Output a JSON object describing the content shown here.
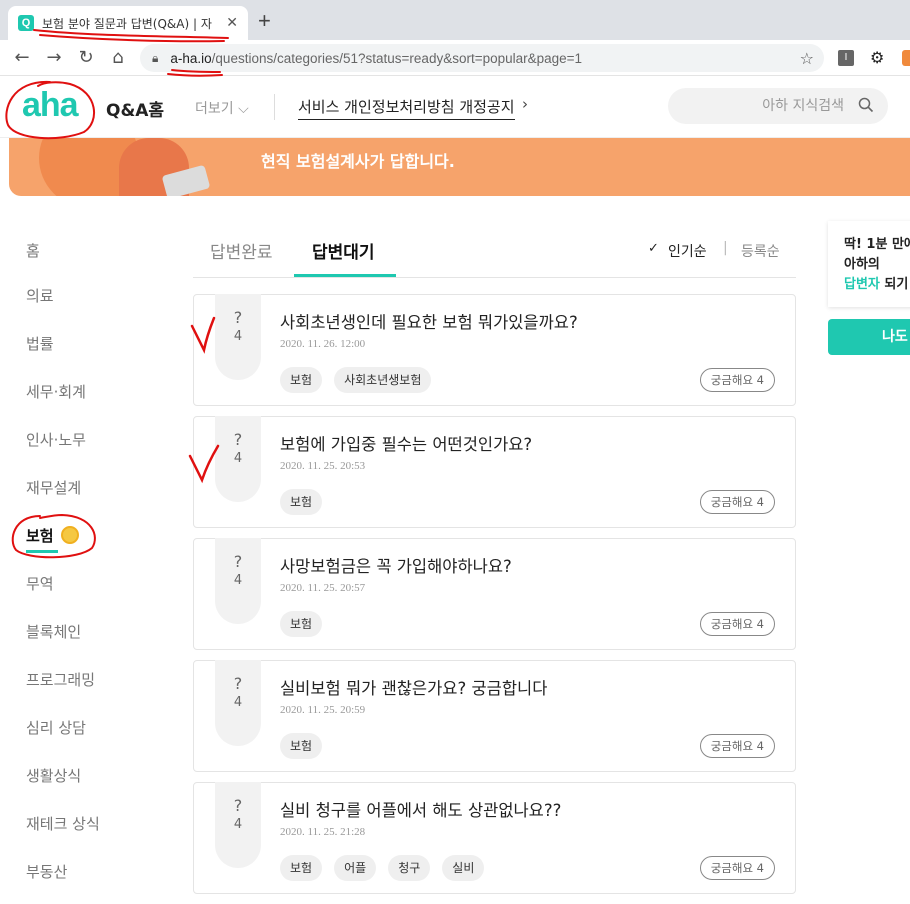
{
  "browser": {
    "tab_title": "보험 분야 질문과 답변(Q&A) | 자",
    "tab_favicon": "Q",
    "url_host": "a-ha.io",
    "url_path": "/questions/categories/51?status=ready&sort=popular&page=1"
  },
  "header": {
    "logo": "aha",
    "home_label": "Q&A홈",
    "more_label": "더보기",
    "notice_label": "서비스 개인정보처리방침 개정공지",
    "search_placeholder": "아하 지식검색"
  },
  "banner": {
    "text": "현직 보험설계사가 답합니다."
  },
  "sidebar": {
    "items": [
      {
        "label": "홈"
      },
      {
        "label": "의료"
      },
      {
        "label": "법률"
      },
      {
        "label": "세무·회계"
      },
      {
        "label": "인사·노무"
      },
      {
        "label": "재무설계"
      },
      {
        "label": "보험",
        "active": true
      },
      {
        "label": "무역"
      },
      {
        "label": "블록체인"
      },
      {
        "label": "프로그래밍"
      },
      {
        "label": "심리 상담"
      },
      {
        "label": "생활상식"
      },
      {
        "label": "재테크 상식"
      },
      {
        "label": "부동산"
      }
    ]
  },
  "tabs": {
    "answered": "답변완료",
    "waiting": "답변대기",
    "active": "waiting",
    "sort_popular": "인기순",
    "sort_recent": "등록순",
    "sort_active": "popular"
  },
  "questions": [
    {
      "title": "사회초년생인데 필요한 보험 뭐가있을까요?",
      "date": "2020. 11. 26. 12:00",
      "count": "4",
      "tags": [
        "보험",
        "사회초년생보험"
      ],
      "curious": "궁금해요 4"
    },
    {
      "title": "보험에 가입중 필수는 어떤것인가요?",
      "date": "2020. 11. 25. 20:53",
      "count": "4",
      "tags": [
        "보험"
      ],
      "curious": "궁금해요 4"
    },
    {
      "title": "사망보험금은 꼭 가입해야하나요?",
      "date": "2020. 11. 25. 20:57",
      "count": "4",
      "tags": [
        "보험"
      ],
      "curious": "궁금해요 4"
    },
    {
      "title": "실비보험 뭐가 괜찮은가요? 궁금합니다",
      "date": "2020. 11. 25. 20:59",
      "count": "4",
      "tags": [
        "보험"
      ],
      "curious": "궁금해요 4"
    },
    {
      "title": "실비 청구를 어플에서 해도 상관없나요??",
      "date": "2020. 11. 25. 21:28",
      "count": "4",
      "tags": [
        "보험",
        "어플",
        "청구",
        "실비"
      ],
      "curious": "궁금해요 4"
    }
  ],
  "promo": {
    "line1": "딱! 1분 만에",
    "line2": "아하의",
    "line3_accent": "답변자",
    "line3_rest": " 되기",
    "button": "나도"
  },
  "colors": {
    "accent": "#1fc8b0",
    "banner": "#f6a36b",
    "annotation": "#e01010"
  }
}
